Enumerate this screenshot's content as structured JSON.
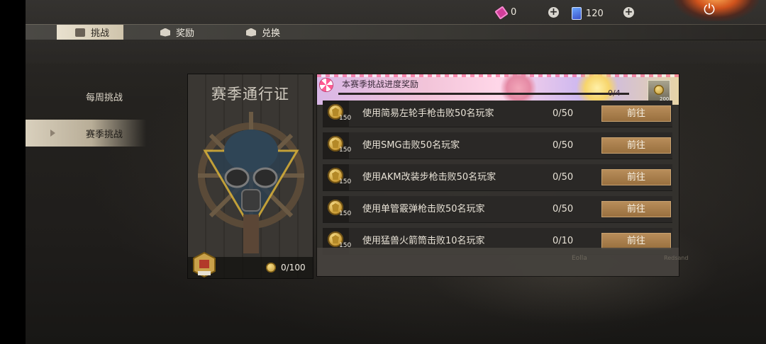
{
  "currency": {
    "tickets": "0",
    "cards": "120"
  },
  "tabs": [
    {
      "label": "挑战",
      "active": true
    },
    {
      "label": "奖励",
      "active": false
    },
    {
      "label": "兑换",
      "active": false
    }
  ],
  "sidebar": {
    "items": [
      {
        "label": "每周挑战",
        "active": false
      },
      {
        "label": "赛季挑战",
        "active": true
      }
    ]
  },
  "season_pass": {
    "title": "赛季通行证",
    "progress": "0/100"
  },
  "banner": {
    "label": "本赛季挑战进度奖励",
    "count": "0/4",
    "reward_points": "200"
  },
  "challenges": [
    {
      "points": "150",
      "text": "使用简易左轮手枪击败50名玩家",
      "progress": "0/50",
      "button": "前往"
    },
    {
      "points": "150",
      "text": "使用SMG击败50名玩家",
      "progress": "0/50",
      "button": "前往"
    },
    {
      "points": "150",
      "text": "使用AKM改装步枪击败50名玩家",
      "progress": "0/50",
      "button": "前往"
    },
    {
      "points": "150",
      "text": "使用单管霰弹枪击败50名玩家",
      "progress": "0/50",
      "button": "前往"
    },
    {
      "points": "150",
      "text": "使用猛兽火箭筒击败10名玩家",
      "progress": "0/10",
      "button": "前往"
    }
  ],
  "map_words": [
    "Eolla",
    "Redsand"
  ],
  "colors": {
    "button": "#a57b48",
    "active_tab": "#e9e1cf",
    "ticket": "#d23e9a",
    "card": "#3b52c9"
  },
  "icons": [
    "ticket-icon",
    "card-icon",
    "plus-icon",
    "power-icon",
    "trophy-icon",
    "box-icon",
    "coin-icon",
    "badge-icon",
    "candy-icon"
  ]
}
